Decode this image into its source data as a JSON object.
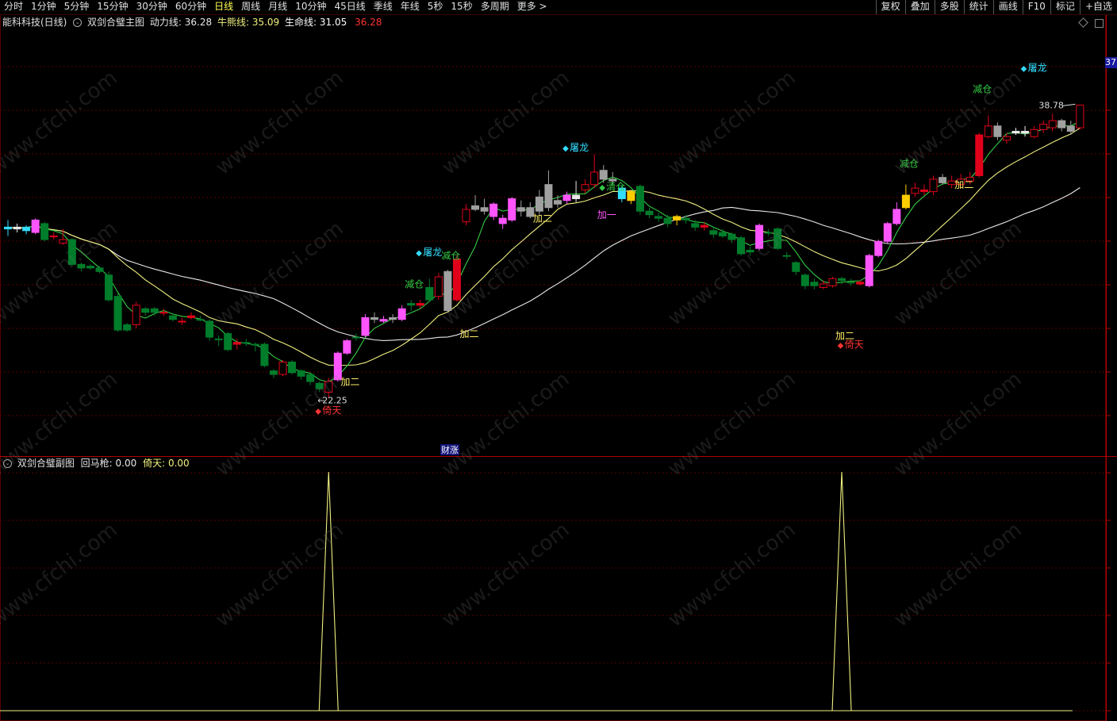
{
  "toolbar": {
    "periods": [
      "分时",
      "1分钟",
      "5分钟",
      "15分钟",
      "30分钟",
      "60分钟",
      "日线",
      "周线",
      "月线",
      "10分钟",
      "45日线",
      "季线",
      "年线",
      "5秒",
      "15秒",
      "多周期",
      "更多 >"
    ],
    "active_period": "日线",
    "tools": [
      "复权",
      "叠加",
      "多股",
      "统计",
      "画线",
      "F10",
      "标记",
      "+自选"
    ]
  },
  "main_header": {
    "stock": "能科科技(日线)",
    "indicator": "双剑合璧主图",
    "line1_label": "动力线:",
    "line1_value": "36.28",
    "line2_label": "牛熊线:",
    "line2_value": "35.09",
    "line3_label": "生命线:",
    "line3_value": "31.05",
    "extra_value": "36.28"
  },
  "sub_header": {
    "indicator": "双剑合璧副图",
    "line1_label": "回马枪:",
    "line1_value": "0.00",
    "line2_label": "倚天:",
    "line2_value": "0.00"
  },
  "price_tag": "37",
  "watermark": "www.cfchi.com",
  "colors": {
    "up": "#e0001a",
    "down": "#007d2a",
    "magenta": "#ff55ff",
    "gray": "#a0a0a0",
    "cyan": "#33ddff",
    "yellow": "#ffcc00",
    "line_white": "#e8e8e8",
    "line_yellow": "#f0f080",
    "line_green": "#33cc44",
    "line_red": "#dd2222"
  },
  "chart_data": {
    "type": "candlestick",
    "candles": [
      {
        "o": 31.8,
        "c": 31.9,
        "h": 32.3,
        "l": 31.4,
        "k": "cyan"
      },
      {
        "o": 31.9,
        "c": 31.8,
        "h": 32.1,
        "l": 31.6,
        "k": "white"
      },
      {
        "o": 31.7,
        "c": 31.9,
        "h": 32.0,
        "l": 31.5,
        "k": "cyan"
      },
      {
        "o": 31.6,
        "c": 32.3,
        "h": 32.4,
        "l": 31.5,
        "k": "magenta"
      },
      {
        "o": 32.1,
        "c": 31.2,
        "h": 32.2,
        "l": 31.1,
        "k": "down"
      },
      {
        "o": 31.4,
        "c": 31.4,
        "h": 31.6,
        "l": 31.2,
        "k": "up"
      },
      {
        "o": 31.0,
        "c": 31.2,
        "h": 31.8,
        "l": 30.9,
        "k": "up"
      },
      {
        "o": 31.2,
        "c": 29.8,
        "h": 31.3,
        "l": 29.7,
        "k": "down"
      },
      {
        "o": 29.8,
        "c": 29.6,
        "h": 29.9,
        "l": 29.4,
        "k": "down"
      },
      {
        "o": 29.7,
        "c": 29.6,
        "h": 29.8,
        "l": 29.5,
        "k": "down"
      },
      {
        "o": 29.6,
        "c": 29.4,
        "h": 29.7,
        "l": 29.3,
        "k": "down"
      },
      {
        "o": 29.2,
        "c": 27.8,
        "h": 29.4,
        "l": 27.7,
        "k": "down"
      },
      {
        "o": 28.0,
        "c": 26.1,
        "h": 28.2,
        "l": 26.0,
        "k": "down"
      },
      {
        "o": 26.1,
        "c": 26.4,
        "h": 26.5,
        "l": 26.0,
        "k": "down"
      },
      {
        "o": 26.4,
        "c": 27.5,
        "h": 27.7,
        "l": 26.2,
        "k": "up"
      },
      {
        "o": 27.3,
        "c": 27.1,
        "h": 27.4,
        "l": 26.9,
        "k": "down"
      },
      {
        "o": 27.3,
        "c": 27.1,
        "h": 27.4,
        "l": 26.9,
        "k": "down"
      },
      {
        "o": 27.1,
        "c": 27.1,
        "h": 27.3,
        "l": 26.9,
        "k": "up"
      },
      {
        "o": 26.9,
        "c": 26.7,
        "h": 27.0,
        "l": 26.6,
        "k": "down"
      },
      {
        "o": 26.6,
        "c": 26.6,
        "h": 26.8,
        "l": 26.4,
        "k": "up"
      },
      {
        "o": 26.8,
        "c": 26.9,
        "h": 27.1,
        "l": 26.7,
        "k": "up"
      },
      {
        "o": 26.7,
        "c": 26.7,
        "h": 26.9,
        "l": 26.6,
        "k": "down"
      },
      {
        "o": 26.6,
        "c": 25.7,
        "h": 26.7,
        "l": 25.5,
        "k": "down"
      },
      {
        "o": 25.6,
        "c": 25.6,
        "h": 25.8,
        "l": 25.2,
        "k": "down"
      },
      {
        "o": 25.9,
        "c": 25.0,
        "h": 26.0,
        "l": 24.9,
        "k": "down"
      },
      {
        "o": 25.3,
        "c": 25.4,
        "h": 25.6,
        "l": 25.0,
        "k": "up"
      },
      {
        "o": 25.4,
        "c": 25.4,
        "h": 25.6,
        "l": 25.2,
        "k": "down"
      },
      {
        "o": 25.3,
        "c": 25.3,
        "h": 25.4,
        "l": 24.9,
        "k": "down"
      },
      {
        "o": 25.3,
        "c": 24.1,
        "h": 25.4,
        "l": 24.0,
        "k": "down"
      },
      {
        "o": 23.8,
        "c": 23.6,
        "h": 23.9,
        "l": 23.4,
        "k": "down"
      },
      {
        "o": 23.6,
        "c": 24.3,
        "h": 24.4,
        "l": 23.5,
        "k": "up"
      },
      {
        "o": 24.3,
        "c": 23.7,
        "h": 24.4,
        "l": 23.6,
        "k": "down"
      },
      {
        "o": 23.8,
        "c": 23.5,
        "h": 23.9,
        "l": 23.3,
        "k": "down"
      },
      {
        "o": 23.6,
        "c": 23.2,
        "h": 23.7,
        "l": 23.0,
        "k": "down"
      },
      {
        "o": 23.1,
        "c": 22.8,
        "h": 23.2,
        "l": 22.6,
        "k": "down"
      },
      {
        "o": 22.6,
        "c": 23.2,
        "h": 23.4,
        "l": 22.25,
        "k": "up"
      },
      {
        "o": 23.3,
        "c": 24.8,
        "h": 24.9,
        "l": 23.2,
        "k": "magenta"
      },
      {
        "o": 24.8,
        "c": 25.5,
        "h": 25.6,
        "l": 24.7,
        "k": "magenta"
      },
      {
        "o": 25.7,
        "c": 25.7,
        "h": 25.9,
        "l": 25.5,
        "k": "down"
      },
      {
        "o": 25.8,
        "c": 26.8,
        "h": 27.0,
        "l": 25.7,
        "k": "magenta"
      },
      {
        "o": 26.7,
        "c": 26.8,
        "h": 27.1,
        "l": 26.5,
        "k": "gray"
      },
      {
        "o": 26.7,
        "c": 26.6,
        "h": 26.9,
        "l": 26.5,
        "k": "magenta"
      },
      {
        "o": 26.7,
        "c": 26.8,
        "h": 27.0,
        "l": 26.5,
        "k": "gray"
      },
      {
        "o": 26.7,
        "c": 27.3,
        "h": 27.5,
        "l": 26.6,
        "k": "magenta"
      },
      {
        "o": 27.5,
        "c": 27.6,
        "h": 27.8,
        "l": 27.2,
        "k": "down"
      },
      {
        "o": 27.6,
        "c": 27.5,
        "h": 27.8,
        "l": 27.3,
        "k": "up"
      },
      {
        "o": 27.8,
        "c": 28.5,
        "h": 29.0,
        "l": 27.7,
        "k": "down"
      },
      {
        "o": 28.0,
        "c": 29.1,
        "h": 29.3,
        "l": 27.8,
        "k": "up"
      },
      {
        "o": 29.4,
        "c": 27.2,
        "h": 29.5,
        "l": 27.1,
        "k": "gray"
      },
      {
        "o": 27.8,
        "c": 30.1,
        "h": 30.3,
        "l": 27.7,
        "k": "up"
      },
      {
        "o": 32.2,
        "c": 32.9,
        "h": 33.2,
        "l": 32.0,
        "k": "up"
      },
      {
        "o": 32.9,
        "c": 33.1,
        "h": 33.7,
        "l": 32.8,
        "k": "gray"
      },
      {
        "o": 33.0,
        "c": 32.8,
        "h": 33.5,
        "l": 32.6,
        "k": "gray"
      },
      {
        "o": 32.5,
        "c": 33.2,
        "h": 33.3,
        "l": 32.3,
        "k": "magenta"
      },
      {
        "o": 32.4,
        "c": 32.1,
        "h": 32.6,
        "l": 31.8,
        "k": "magenta"
      },
      {
        "o": 32.3,
        "c": 33.5,
        "h": 33.6,
        "l": 32.2,
        "k": "magenta"
      },
      {
        "o": 33.0,
        "c": 32.8,
        "h": 33.4,
        "l": 32.5,
        "k": "gray"
      },
      {
        "o": 32.5,
        "c": 33.0,
        "h": 33.3,
        "l": 32.4,
        "k": "gray"
      },
      {
        "o": 32.8,
        "c": 33.6,
        "h": 34.0,
        "l": 32.6,
        "k": "gray"
      },
      {
        "o": 33.0,
        "c": 34.3,
        "h": 35.1,
        "l": 32.8,
        "k": "gray"
      },
      {
        "o": 33.2,
        "c": 33.4,
        "h": 33.7,
        "l": 33.0,
        "k": "gray"
      },
      {
        "o": 33.4,
        "c": 33.7,
        "h": 33.9,
        "l": 33.2,
        "k": "magenta"
      },
      {
        "o": 33.5,
        "c": 33.7,
        "h": 34.5,
        "l": 33.3,
        "k": "white"
      },
      {
        "o": 34.0,
        "c": 34.3,
        "h": 34.6,
        "l": 33.8,
        "k": "up"
      },
      {
        "o": 34.3,
        "c": 35.0,
        "h": 36.0,
        "l": 34.1,
        "k": "up"
      },
      {
        "o": 34.6,
        "c": 35.1,
        "h": 35.4,
        "l": 34.4,
        "k": "gray"
      },
      {
        "o": 34.6,
        "c": 34.5,
        "h": 35.0,
        "l": 34.3,
        "k": "gray"
      },
      {
        "o": 34.1,
        "c": 33.5,
        "h": 34.2,
        "l": 33.3,
        "k": "cyan"
      },
      {
        "o": 33.9,
        "c": 33.4,
        "h": 34.0,
        "l": 33.2,
        "k": "yellow"
      },
      {
        "o": 34.2,
        "c": 32.8,
        "h": 34.3,
        "l": 32.6,
        "k": "down"
      },
      {
        "o": 32.8,
        "c": 32.6,
        "h": 33.0,
        "l": 32.4,
        "k": "down"
      },
      {
        "o": 32.5,
        "c": 32.4,
        "h": 32.7,
        "l": 32.2,
        "k": "down"
      },
      {
        "o": 32.4,
        "c": 32.1,
        "h": 32.6,
        "l": 31.9,
        "k": "down"
      },
      {
        "o": 32.3,
        "c": 32.5,
        "h": 32.6,
        "l": 32.0,
        "k": "yellow"
      },
      {
        "o": 32.4,
        "c": 32.3,
        "h": 32.6,
        "l": 32.1,
        "k": "down"
      },
      {
        "o": 32.1,
        "c": 31.9,
        "h": 32.3,
        "l": 31.7,
        "k": "down"
      },
      {
        "o": 32.0,
        "c": 31.9,
        "h": 32.2,
        "l": 31.7,
        "k": "up"
      },
      {
        "o": 31.7,
        "c": 31.5,
        "h": 31.9,
        "l": 31.3,
        "k": "down"
      },
      {
        "o": 31.6,
        "c": 31.4,
        "h": 31.8,
        "l": 31.3,
        "k": "down"
      },
      {
        "o": 31.5,
        "c": 31.2,
        "h": 31.6,
        "l": 31.0,
        "k": "down"
      },
      {
        "o": 31.3,
        "c": 30.4,
        "h": 31.4,
        "l": 30.3,
        "k": "down"
      },
      {
        "o": 30.6,
        "c": 30.5,
        "h": 30.8,
        "l": 30.3,
        "k": "down"
      },
      {
        "o": 30.7,
        "c": 32.0,
        "h": 32.1,
        "l": 30.6,
        "k": "magenta"
      },
      {
        "o": 31.6,
        "c": 31.6,
        "h": 31.8,
        "l": 31.4,
        "k": "down"
      },
      {
        "o": 31.8,
        "c": 30.7,
        "h": 31.9,
        "l": 30.6,
        "k": "down"
      },
      {
        "o": 30.3,
        "c": 30.3,
        "h": 30.5,
        "l": 30.1,
        "k": "down"
      },
      {
        "o": 29.9,
        "c": 29.4,
        "h": 30.0,
        "l": 29.2,
        "k": "down"
      },
      {
        "o": 29.2,
        "c": 28.6,
        "h": 29.3,
        "l": 28.4,
        "k": "down"
      },
      {
        "o": 28.8,
        "c": 28.6,
        "h": 29.0,
        "l": 28.4,
        "k": "down"
      },
      {
        "o": 28.5,
        "c": 28.7,
        "h": 28.9,
        "l": 28.4,
        "k": "up"
      },
      {
        "o": 28.6,
        "c": 29.0,
        "h": 29.1,
        "l": 28.5,
        "k": "up"
      },
      {
        "o": 29.0,
        "c": 28.9,
        "h": 29.1,
        "l": 28.7,
        "k": "down"
      },
      {
        "o": 28.8,
        "c": 28.8,
        "h": 29.0,
        "l": 28.6,
        "k": "down"
      },
      {
        "o": 28.7,
        "c": 28.8,
        "h": 28.9,
        "l": 28.6,
        "k": "up"
      },
      {
        "o": 28.6,
        "c": 30.3,
        "h": 30.4,
        "l": 28.5,
        "k": "magenta"
      },
      {
        "o": 30.3,
        "c": 31.1,
        "h": 31.2,
        "l": 30.2,
        "k": "magenta"
      },
      {
        "o": 31.1,
        "c": 32.1,
        "h": 32.2,
        "l": 31.0,
        "k": "magenta"
      },
      {
        "o": 32.1,
        "c": 32.9,
        "h": 33.3,
        "l": 32.0,
        "k": "magenta"
      },
      {
        "o": 33.0,
        "c": 33.7,
        "h": 34.3,
        "l": 32.9,
        "k": "yellow"
      },
      {
        "o": 33.8,
        "c": 34.1,
        "h": 34.4,
        "l": 33.6,
        "k": "up"
      },
      {
        "o": 34.0,
        "c": 33.9,
        "h": 34.3,
        "l": 33.7,
        "k": "up"
      },
      {
        "o": 33.9,
        "c": 34.6,
        "h": 34.8,
        "l": 33.7,
        "k": "up"
      },
      {
        "o": 34.4,
        "c": 34.7,
        "h": 34.9,
        "l": 34.3,
        "k": "gray"
      },
      {
        "o": 34.3,
        "c": 34.5,
        "h": 34.8,
        "l": 34.1,
        "k": "up"
      },
      {
        "o": 34.3,
        "c": 34.6,
        "h": 34.9,
        "l": 34.2,
        "k": "up"
      },
      {
        "o": 34.5,
        "c": 34.7,
        "h": 35.0,
        "l": 34.3,
        "k": "up"
      },
      {
        "o": 34.8,
        "c": 37.1,
        "h": 37.2,
        "l": 34.7,
        "k": "up"
      },
      {
        "o": 37.0,
        "c": 37.6,
        "h": 38.2,
        "l": 36.9,
        "k": "up"
      },
      {
        "o": 37.6,
        "c": 37.0,
        "h": 37.8,
        "l": 36.8,
        "k": "gray"
      },
      {
        "o": 36.8,
        "c": 37.0,
        "h": 37.2,
        "l": 36.6,
        "k": "up"
      },
      {
        "o": 37.2,
        "c": 37.3,
        "h": 37.5,
        "l": 37.1,
        "k": "white"
      },
      {
        "o": 37.2,
        "c": 37.3,
        "h": 37.6,
        "l": 37.0,
        "k": "white"
      },
      {
        "o": 37.0,
        "c": 37.4,
        "h": 37.6,
        "l": 36.9,
        "k": "up"
      },
      {
        "o": 37.4,
        "c": 37.7,
        "h": 37.9,
        "l": 37.2,
        "k": "up"
      },
      {
        "o": 37.5,
        "c": 37.9,
        "h": 38.3,
        "l": 37.3,
        "k": "up"
      },
      {
        "o": 37.9,
        "c": 37.5,
        "h": 38.0,
        "l": 37.3,
        "k": "gray"
      },
      {
        "o": 37.6,
        "c": 37.3,
        "h": 37.9,
        "l": 37.1,
        "k": "gray"
      },
      {
        "o": 37.5,
        "c": 38.78,
        "h": 38.78,
        "l": 37.4,
        "k": "up"
      }
    ],
    "high_label": "38.78",
    "low_label": "22.25",
    "signals": [
      {
        "text": "倚天",
        "i": 35,
        "y": 21.4,
        "c": "#ff3333"
      },
      {
        "text": "加二",
        "i": 37,
        "y": 23.0,
        "c": "#ffee66"
      },
      {
        "text": "减仓",
        "i": 44,
        "y": 28.5,
        "c": "#33cc44"
      },
      {
        "text": "屠龙",
        "i": 46,
        "y": 30.3,
        "c": "#33ddff"
      },
      {
        "text": "减仓",
        "i": 48,
        "y": 30.1,
        "c": "#33cc44"
      },
      {
        "text": "加二",
        "i": 50,
        "y": 25.7,
        "c": "#ffee66"
      },
      {
        "text": "屠龙",
        "i": 62,
        "y": 36.2,
        "c": "#33ddff"
      },
      {
        "text": "加二",
        "i": 58,
        "y": 32.2,
        "c": "#ffee66"
      },
      {
        "text": "清仓",
        "i": 66,
        "y": 34.0,
        "c": "#33cc44"
      },
      {
        "text": "加一",
        "i": 65,
        "y": 32.4,
        "c": "#ff55ff"
      },
      {
        "text": "加二",
        "i": 91,
        "y": 25.6,
        "c": "#ffee66"
      },
      {
        "text": "倚天",
        "i": 92,
        "y": 25.1,
        "c": "#ff3333"
      },
      {
        "text": "减仓",
        "i": 98,
        "y": 35.3,
        "c": "#33cc44"
      },
      {
        "text": "加二",
        "i": 104,
        "y": 34.1,
        "c": "#ffee66"
      },
      {
        "text": "减仓",
        "i": 106,
        "y": 39.5,
        "c": "#33cc44"
      },
      {
        "text": "屠龙",
        "i": 112,
        "y": 40.7,
        "c": "#33ddff"
      }
    ],
    "bottom_label": "财涨",
    "sub_spikes": [
      35,
      91
    ],
    "price_range": [
      19.0,
      43.0
    ]
  }
}
